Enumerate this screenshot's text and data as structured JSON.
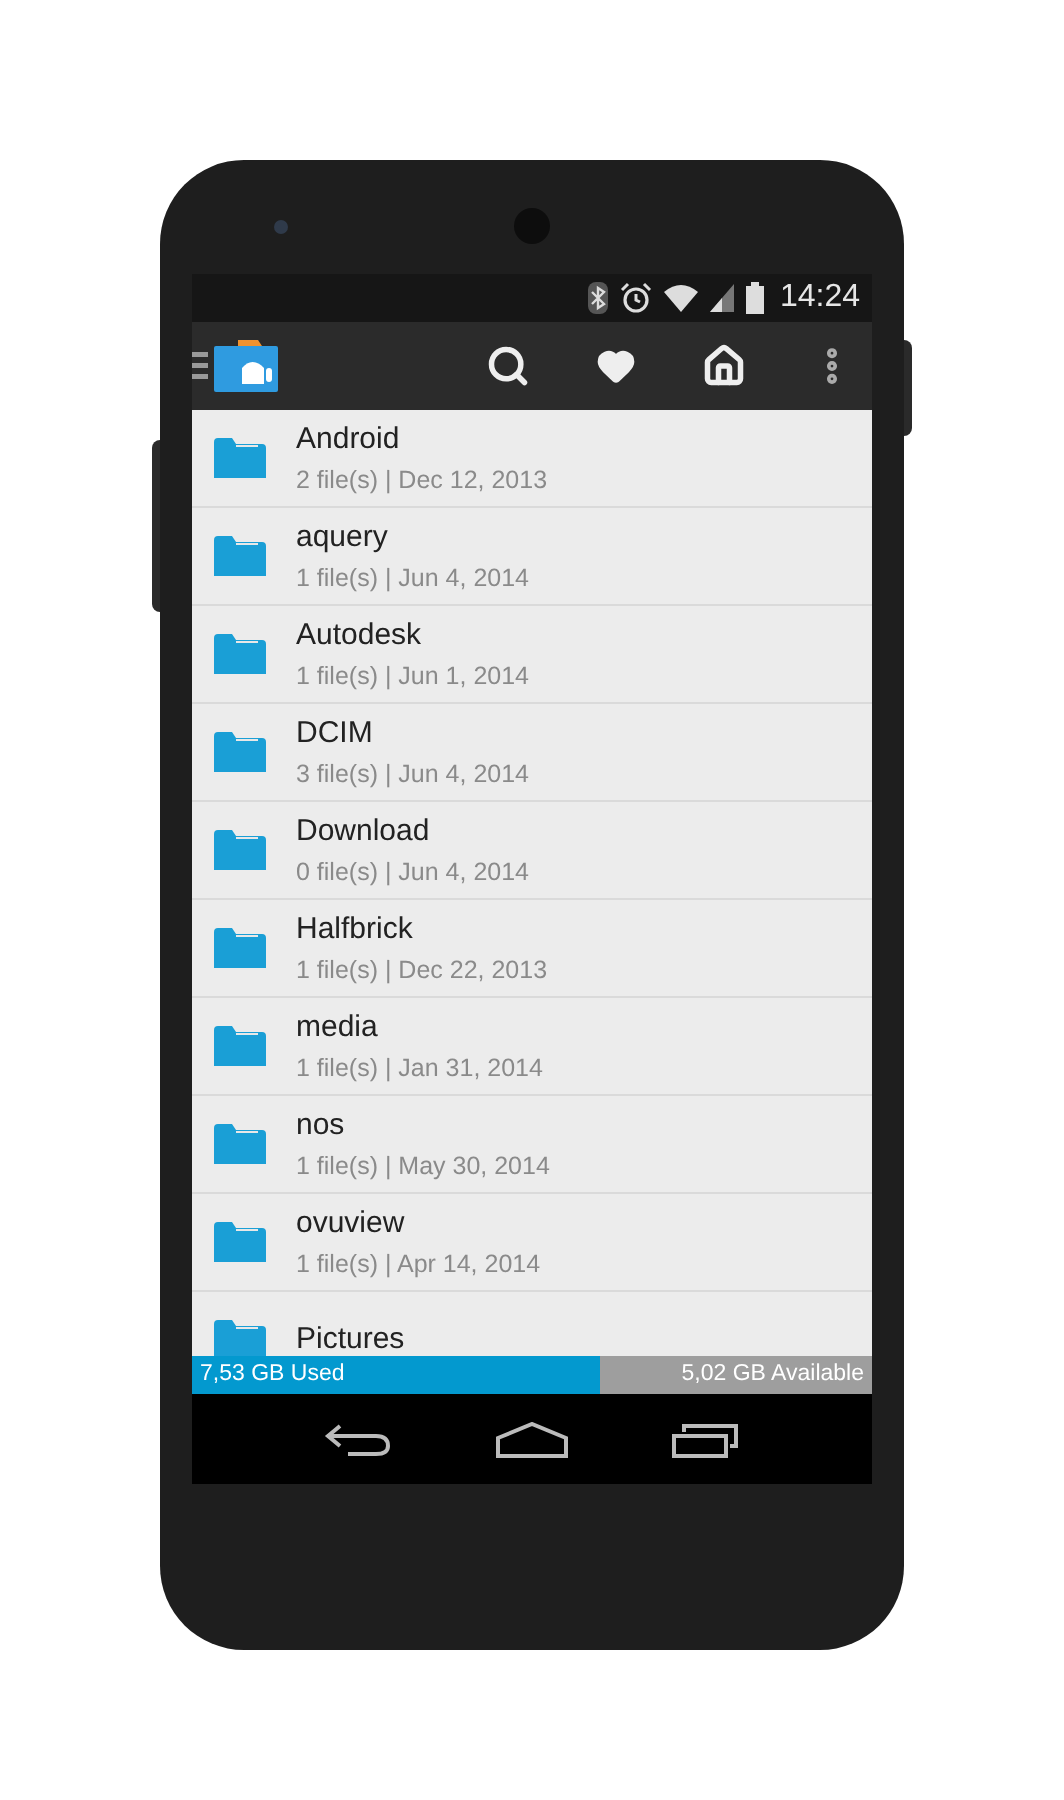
{
  "status_bar": {
    "time": "14:24"
  },
  "folders": [
    {
      "name": "Android",
      "details": "2 file(s) | Dec 12, 2013"
    },
    {
      "name": "aquery",
      "details": "1 file(s) | Jun 4, 2014"
    },
    {
      "name": "Autodesk",
      "details": "1 file(s) | Jun 1, 2014"
    },
    {
      "name": "DCIM",
      "details": "3 file(s) | Jun 4, 2014"
    },
    {
      "name": "Download",
      "details": "0 file(s) | Jun 4, 2014"
    },
    {
      "name": "Halfbrick",
      "details": "1 file(s) | Dec 22, 2013"
    },
    {
      "name": "media",
      "details": "1 file(s) | Jan 31, 2014"
    },
    {
      "name": "nos",
      "details": "1 file(s) | May 30, 2014"
    },
    {
      "name": "ovuview",
      "details": "1 file(s) | Apr 14, 2014"
    },
    {
      "name": "Pictures"
    }
  ],
  "storage": {
    "used": "7,53 GB Used",
    "available": "5,02 GB Available",
    "level": 0.6
  }
}
